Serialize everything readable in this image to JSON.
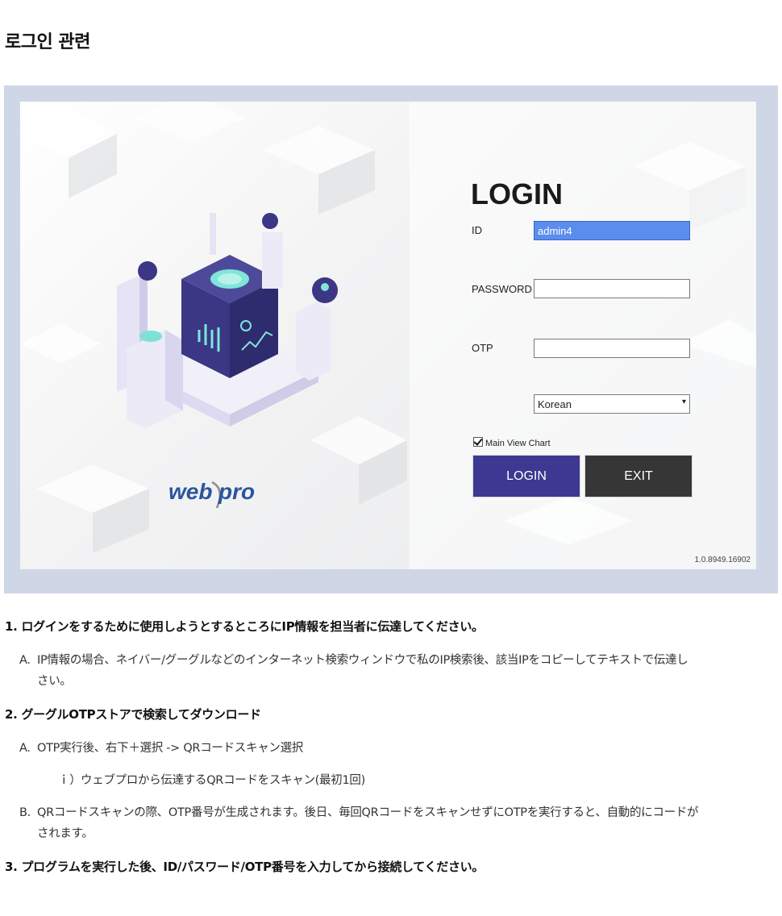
{
  "page": {
    "heading": "로그인 관련"
  },
  "login_screen": {
    "title": "LOGIN",
    "id_label": "ID",
    "id_value": "admin4",
    "password_label": "PASSWORD",
    "password_value": "",
    "otp_label": "OTP",
    "otp_value": "",
    "language_selected": "Korean",
    "checkbox_label": "Main View Chart",
    "checkbox_checked": true,
    "login_button": "LOGIN",
    "exit_button": "EXIT",
    "version": "1.0.8949.16902",
    "logo_text_left": "web",
    "logo_text_right": "pro",
    "colors": {
      "login_button": "#3d3891",
      "exit_button": "#363636",
      "id_highlight": "#5b8def",
      "frame": "#cfd6e6"
    }
  },
  "instructions": [
    {
      "number": "1.",
      "title": "ログインをするために使用しようとするところにIP情報を担当者に伝達してください。",
      "items": [
        {
          "marker": "A.",
          "text": "IP情報の場合、ネイバー/グーグルなどのインターネット検索ウィンドウで私のIP検索後、該当IPをコピーしてテキストで伝達し",
          "text_cont": "さい。"
        }
      ]
    },
    {
      "number": "2.",
      "title": "グーグルOTPストアで検索してダウンロード",
      "items": [
        {
          "marker": "A.",
          "text": "OTP実行後、右下＋選択 -> QRコードスキャン選択"
        },
        {
          "marker": "ｉ）",
          "text": "ウェブプロから伝達するQRコードをスキャン(最初1回)"
        },
        {
          "marker": "B.",
          "text": "QRコードスキャンの際、OTP番号が生成されます。後日、毎回QRコードをスキャンせずにOTPを実行すると、自動的にコードが",
          "text_cont": "されます。"
        }
      ]
    },
    {
      "number": "3.",
      "title": "プログラムを実行した後、ID/パスワード/OTP番号を入力してから接続してください。",
      "items": []
    }
  ]
}
